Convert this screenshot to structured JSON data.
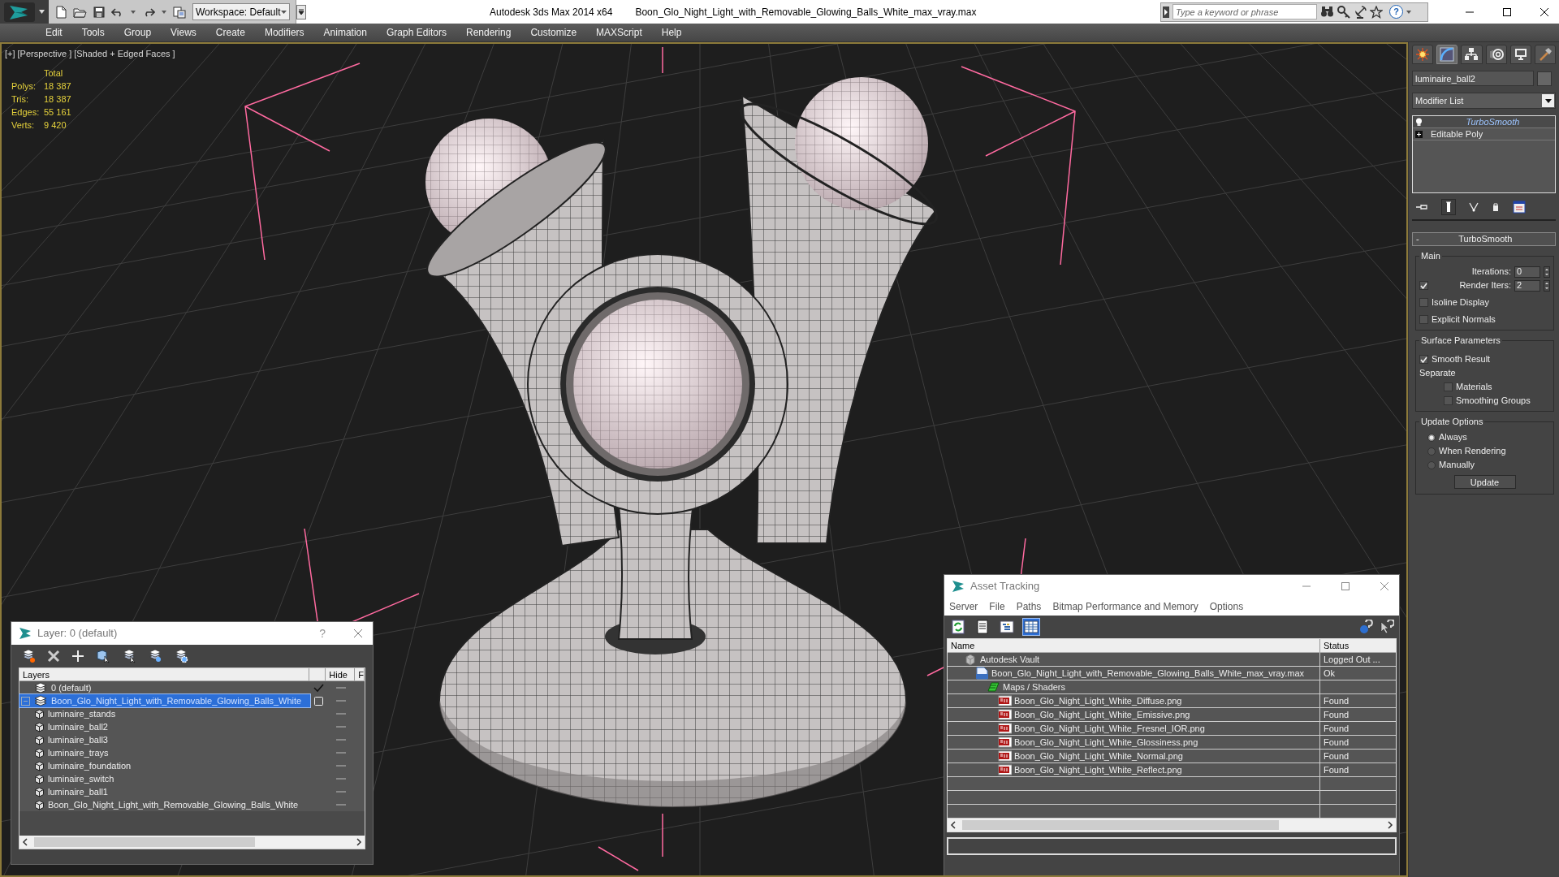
{
  "title_bar": {
    "workspace": "Workspace: Default",
    "app_title": "Autodesk 3ds Max 2014 x64",
    "file_title": "Boon_Glo_Night_Light_with_Removable_Glowing_Balls_White_max_vray.max",
    "search": {
      "placeholder": "Type a keyword or phrase"
    },
    "help": "?"
  },
  "menu": [
    "Edit",
    "Tools",
    "Group",
    "Views",
    "Create",
    "Modifiers",
    "Animation",
    "Graph Editors",
    "Rendering",
    "Customize",
    "MAXScript",
    "Help"
  ],
  "viewport": {
    "labels": [
      "[+]",
      "[Perspective ]",
      "[Shaded + Edged Faces ]"
    ],
    "stats": {
      "header": "Total",
      "rows": [
        {
          "label": "Polys:",
          "value": "18 387"
        },
        {
          "label": "Tris:",
          "value": "18 387"
        },
        {
          "label": "Edges:",
          "value": "55 161"
        },
        {
          "label": "Verts:",
          "value": "9 420"
        }
      ]
    }
  },
  "command_panel": {
    "tabs": [
      {
        "kind": "create",
        "selected": false
      },
      {
        "kind": "modify",
        "selected": true
      },
      {
        "kind": "hierarchy",
        "selected": false
      },
      {
        "kind": "motion",
        "selected": false
      },
      {
        "kind": "display",
        "selected": false
      },
      {
        "kind": "utilities",
        "selected": false
      }
    ],
    "object_name": "luminaire_ball2",
    "modifier_list": "Modifier List",
    "stack": [
      {
        "kind": "modifier",
        "label": "TurboSmooth",
        "selected": true
      },
      {
        "kind": "base",
        "label": "Editable Poly",
        "selected": false
      }
    ],
    "rollout": {
      "toggle": "-",
      "title": "TurboSmooth",
      "groups": [
        {
          "title": "Main",
          "items": [
            {
              "kind": "spinner",
              "label": "Iterations:",
              "value": "0"
            },
            {
              "kind": "check_spinner",
              "label": "Render Iters:",
              "value": "2",
              "checked": true
            },
            {
              "kind": "checkbox",
              "label": "Isoline Display",
              "checked": false
            },
            {
              "kind": "checkbox",
              "label": "Explicit Normals",
              "checked": false
            }
          ]
        },
        {
          "title": "Surface Parameters",
          "items": [
            {
              "kind": "checkbox",
              "label": "Smooth Result",
              "checked": true
            },
            {
              "kind": "text",
              "label": "Separate"
            },
            {
              "kind": "subcheckbox",
              "label": "Materials",
              "checked": false
            },
            {
              "kind": "subcheckbox",
              "label": "Smoothing Groups",
              "checked": false
            }
          ]
        },
        {
          "title": "Update Options",
          "items": [
            {
              "kind": "radio",
              "label": "Always",
              "selected": true
            },
            {
              "kind": "radio",
              "label": "When Rendering",
              "selected": false
            },
            {
              "kind": "radio",
              "label": "Manually",
              "selected": false
            },
            {
              "kind": "button",
              "label": "Update"
            }
          ]
        }
      ]
    }
  },
  "layer_window": {
    "title": "Layer: 0 (default)",
    "help": "?",
    "columns": [
      "Layers",
      "Hide",
      "F"
    ],
    "rows": [
      {
        "kind": "layer",
        "name": "0 (default)",
        "active": true,
        "selected": false
      },
      {
        "kind": "layer",
        "name": "Boon_Glo_Night_Light_with_Removable_Glowing_Balls_White",
        "active": false,
        "selected": true,
        "expanded": true,
        "children": [
          {
            "kind": "object",
            "name": "luminaire_stands",
            "selected": false
          },
          {
            "kind": "object",
            "name": "luminaire_ball2",
            "selected": false
          },
          {
            "kind": "object",
            "name": "luminaire_ball3",
            "selected": false
          },
          {
            "kind": "object",
            "name": "luminaire_trays",
            "selected": false
          },
          {
            "kind": "object",
            "name": "luminaire_foundation",
            "selected": false
          },
          {
            "kind": "object",
            "name": "luminaire_switch",
            "selected": false
          },
          {
            "kind": "object",
            "name": "luminaire_ball1",
            "selected": false
          },
          {
            "kind": "object",
            "name": "Boon_Glo_Night_Light_with_Removable_Glowing_Balls_White",
            "selected": false
          }
        ]
      }
    ]
  },
  "asset_window": {
    "title": "Asset Tracking",
    "menu": [
      "Server",
      "File",
      "Paths",
      "Bitmap Performance and Memory",
      "Options"
    ],
    "view_buttons": [
      {
        "selected": false
      },
      {
        "selected": false
      },
      {
        "selected": false
      },
      {
        "selected": true
      }
    ],
    "columns": [
      "Name",
      "Status"
    ],
    "rows": [
      {
        "kind": "vault",
        "name": "Autodesk Vault",
        "status": "Logged Out ...",
        "children": [
          {
            "kind": "max",
            "name": "Boon_Glo_Night_Light_with_Removable_Glowing_Balls_White_max_vray.max",
            "status": "Ok",
            "children": [
              {
                "kind": "folder",
                "name": "Maps / Shaders",
                "children": [
                  {
                    "kind": "png",
                    "name": "Boon_Glo_Night_Light_White_Diffuse.png",
                    "status": "Found"
                  },
                  {
                    "kind": "png",
                    "name": "Boon_Glo_Night_Light_White_Emissive.png",
                    "status": "Found"
                  },
                  {
                    "kind": "png",
                    "name": "Boon_Glo_Night_Light_White_Fresnel_IOR.png",
                    "status": "Found"
                  },
                  {
                    "kind": "png",
                    "name": "Boon_Glo_Night_Light_White_Glossiness.png",
                    "status": "Found"
                  },
                  {
                    "kind": "png",
                    "name": "Boon_Glo_Night_Light_White_Normal.png",
                    "status": "Found"
                  },
                  {
                    "kind": "png",
                    "name": "Boon_Glo_Night_Light_White_Reflect.png",
                    "status": "Found"
                  }
                ]
              }
            ]
          }
        ]
      }
    ]
  }
}
